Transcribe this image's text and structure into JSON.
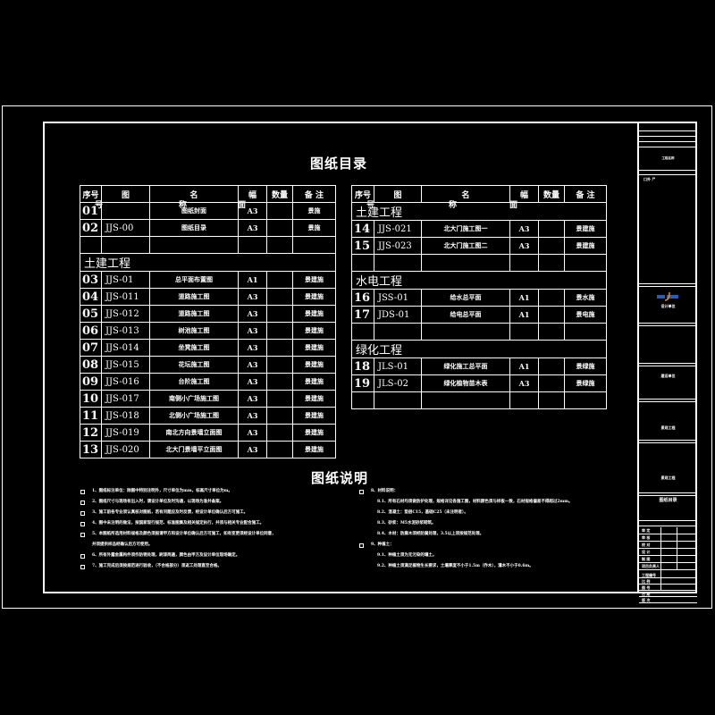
{
  "drawing": {
    "catalog_title": "图纸目录",
    "notes_title": "图纸说明",
    "headers": {
      "no": "序号",
      "name_a": "图",
      "name_b": "名",
      "sub_hao": "号",
      "sub_cheng": "称",
      "size_a": "幅",
      "size_b": "面",
      "qty": "数量",
      "remark": "备 注"
    },
    "left_table": [
      {
        "type": "row",
        "no": "01",
        "code": "",
        "name": "图纸封面",
        "size": "A3",
        "remark": "景施"
      },
      {
        "type": "row",
        "no": "02",
        "code": "JJS-00",
        "name": "图纸目录",
        "size": "A3",
        "remark": "景施"
      },
      {
        "type": "blank"
      },
      {
        "type": "section",
        "label": "土建工程"
      },
      {
        "type": "row",
        "no": "03",
        "code": "JJS-01",
        "name": "总平面布置图",
        "size": "A1",
        "remark": "景建施"
      },
      {
        "type": "row",
        "no": "04",
        "code": "JJS-011",
        "name": "道路施工图",
        "size": "A3",
        "remark": "景建施"
      },
      {
        "type": "row",
        "no": "05",
        "code": "JJS-012",
        "name": "道路施工图",
        "size": "A3",
        "remark": "景建施"
      },
      {
        "type": "row",
        "no": "06",
        "code": "JJS-013",
        "name": "树池施工图",
        "size": "A3",
        "remark": "景建施"
      },
      {
        "type": "row",
        "no": "07",
        "code": "JJS-014",
        "name": "坐凳施工图",
        "size": "A3",
        "remark": "景建施"
      },
      {
        "type": "row",
        "no": "08",
        "code": "JJS-015",
        "name": "花坛施工图",
        "size": "A3",
        "remark": "景建施"
      },
      {
        "type": "row",
        "no": "09",
        "code": "JJS-016",
        "name": "台阶施工图",
        "size": "A3",
        "remark": "景建施"
      },
      {
        "type": "row",
        "no": "10",
        "code": "JJS-017",
        "name": "南侧小广场施工图",
        "size": "A3",
        "remark": "景建施"
      },
      {
        "type": "row",
        "no": "11",
        "code": "JJS-018",
        "name": "北侧小广场施工图",
        "size": "A3",
        "remark": "景建施"
      },
      {
        "type": "row",
        "no": "12",
        "code": "JJS-019",
        "name": "南北方向景墙立面图",
        "size": "A3",
        "remark": "景建施"
      },
      {
        "type": "row",
        "no": "13",
        "code": "JJS-020",
        "name": "北大门景墙平立面图",
        "size": "A3",
        "remark": "景建施"
      }
    ],
    "right_table": [
      {
        "type": "section",
        "label": "土建工程"
      },
      {
        "type": "row",
        "no": "14",
        "code": "JJS-021",
        "name": "北大门施工图一",
        "size": "A3",
        "remark": "景建施"
      },
      {
        "type": "row",
        "no": "15",
        "code": "JJS-023",
        "name": "北大门施工图二",
        "size": "A3",
        "remark": "景建施"
      },
      {
        "type": "blank"
      },
      {
        "type": "section",
        "label": "水电工程"
      },
      {
        "type": "row",
        "no": "16",
        "code": "JSS-01",
        "name": "给水总平面",
        "size": "A1",
        "remark": "景水施"
      },
      {
        "type": "row",
        "no": "17",
        "code": "JDS-01",
        "name": "给电总平面",
        "size": "A1",
        "remark": "景电施"
      },
      {
        "type": "blank"
      },
      {
        "type": "section",
        "label": "绿化工程"
      },
      {
        "type": "row",
        "no": "18",
        "code": "JLS-01",
        "name": "绿化施工总平面",
        "size": "A1",
        "remark": "景绿施"
      },
      {
        "type": "row",
        "no": "19",
        "code": "JLS-02",
        "name": "绿化植物苗木表",
        "size": "A3",
        "remark": "景绿施"
      },
      {
        "type": "blank"
      }
    ],
    "notes_left": [
      "1、图纸标注单位：除图中特别注明外，尺寸单位为mm，标高尺寸单位为m。",
      "2、图纸尺寸与现场有出入时，请设计单位及时沟通，以现场为准并备案。",
      "3、施工前各专业须认真核对图纸，若有问题应及时反馈，经设计单位确认后方可施工。",
      "4、图中未注明的做法，按国家现行规范、标准图集及相关规定执行，并须与相关专业配合施工。",
      "5、本图纸所选用材料规格及颜色须报请甲方和设计单位确认后方可施工，如有变更须经设计单位同意，",
      "   并须提供样品经确认后方可使用。",
      "6、所有外露金属构件须作防锈处理，刷漆两遍，颜色由甲方及设计单位现场确定。",
      "7、施工完成后须按规范进行验收，（不合格部分）须返工处理直至合格。"
    ],
    "notes_right_heads": [
      "8、材料说明：",
      "9、种植土："
    ],
    "notes_right_8": [
      "8.1、所有石材均须做防护处理，规格详见各施工图，材料颜色须与样板一致，石材规格偏差不得超过2mm。",
      "8.2、混凝土：垫层C15，基础C25（未注明者）。",
      "8.3、砂浆：M5水泥砂浆砌筑。",
      "8.4、木材：防腐木须经防腐处理，3.5以上须按规范处理。"
    ],
    "notes_right_9": [
      "9.1、种植土须为无污染的壤土。",
      "9.2、种植土须满足植物生长要求，土壤厚度不小于1.5m（乔木），灌木不小于0.6m。"
    ],
    "title_block": {
      "field1": "工程名称",
      "company_line": "建设单位",
      "design_unit": "设计单位",
      "project_name": "景观工程",
      "drawing_title": "图纸目录",
      "rows": [
        "审 定",
        "审 核",
        "校 对",
        "设 计",
        "制 图",
        "项目负责人"
      ],
      "bottom_rows": [
        "工程编号",
        "比 例",
        "图 号",
        "日 期",
        "版 次"
      ]
    }
  }
}
